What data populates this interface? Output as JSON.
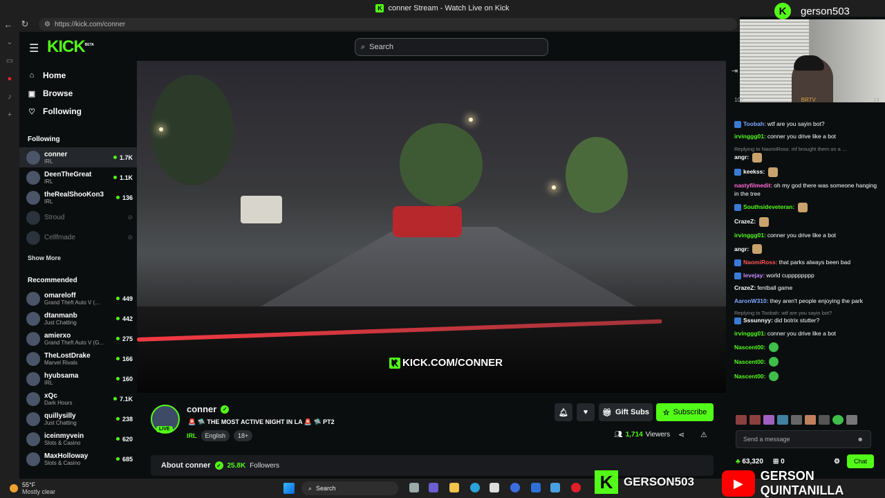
{
  "browser": {
    "tab_title": "conner Stream - Watch Live on Kick",
    "url": "https://kick.com/conner"
  },
  "header": {
    "logo": "KICK",
    "logo_sup": "BETA",
    "search_placeholder": "Search"
  },
  "sidebar": {
    "nav": [
      {
        "label": "Home",
        "icon": "home-icon"
      },
      {
        "label": "Browse",
        "icon": "browse-icon"
      },
      {
        "label": "Following",
        "icon": "heart-icon"
      }
    ],
    "following_title": "Following",
    "following": [
      {
        "name": "conner",
        "sub": "IRL",
        "count": "1.7K",
        "live": true
      },
      {
        "name": "DeenTheGreat",
        "sub": "IRL",
        "count": "1.1K",
        "live": true
      },
      {
        "name": "theRealShooKon3",
        "sub": "IRL",
        "count": "136",
        "live": true
      },
      {
        "name": "Stroud",
        "sub": "",
        "count": "",
        "live": false
      },
      {
        "name": "Cellfmade",
        "sub": "",
        "count": "",
        "live": false
      }
    ],
    "show_more": "Show More",
    "recommended_title": "Recommended",
    "recommended": [
      {
        "name": "omareloff",
        "sub": "Grand Theft Auto V (...",
        "count": "449"
      },
      {
        "name": "dtanmanb",
        "sub": "Just Chatting",
        "count": "442"
      },
      {
        "name": "amierxo",
        "sub": "Grand Theft Auto V (G...",
        "count": "275"
      },
      {
        "name": "TheLostDrake",
        "sub": "Marvel Rivals",
        "count": "166"
      },
      {
        "name": "hyubsama",
        "sub": "IRL",
        "count": "160"
      },
      {
        "name": "xQc",
        "sub": "Dark Hours",
        "count": "7.1K"
      },
      {
        "name": "quillysilly",
        "sub": "Just Chatting",
        "count": "238"
      },
      {
        "name": "iceinmyvein",
        "sub": "Slots & Casino",
        "count": "620"
      },
      {
        "name": "MaxHolloway",
        "sub": "Slots & Casino",
        "count": "685"
      }
    ]
  },
  "video": {
    "watermark": "KICK.COM/CONNER"
  },
  "stream": {
    "username": "conner",
    "live_label": "LIVE",
    "title": "🚨 🛸 THE MOST ACTIVE NIGHT IN LA 🚨 🛸 PT2",
    "category": "IRL",
    "tags": [
      "English",
      "18+"
    ],
    "gift_subs": "Gift Subs",
    "subscribe": "Subscribe",
    "viewers": "1,714",
    "viewers_label": "Viewers",
    "about_label": "About conner",
    "followers": "25.8K",
    "followers_label": "Followers"
  },
  "chat": {
    "pinned_left": "102",
    "pinned_mid": "BRTV",
    "pinned_right": "14",
    "messages": [
      {
        "user": "Toobah:",
        "color": "#7ea8ff",
        "text": "wtf are you sayin bot?",
        "badge": true
      },
      {
        "user": "irvinggg01:",
        "color": "#53fc18",
        "text": "conner you drive like a bot"
      },
      {
        "reply": "Replying to NaomiRoss: mf brought them on a ...",
        "user": "angr:",
        "color": "#ffffff",
        "text": "",
        "emote": "emote"
      },
      {
        "user": "keekss:",
        "color": "#ffffff",
        "text": "",
        "emote": "emote",
        "badge": true
      },
      {
        "user": "nastyfilmedit:",
        "color": "#ff6bd6",
        "text": "oh my god there was someone hanging in the tree"
      },
      {
        "user": "Southsideveteran:",
        "color": "#53fc18",
        "text": "",
        "emote": "emote",
        "badge": true
      },
      {
        "user": "CrazeZ:",
        "color": "#ffffff",
        "text": "",
        "emote": "emote"
      },
      {
        "user": "irvinggg01:",
        "color": "#53fc18",
        "text": "conner you drive like a bot"
      },
      {
        "user": "angr:",
        "color": "#ffffff",
        "text": "",
        "emote": "emote"
      },
      {
        "user": "NaomiRoss:",
        "color": "#ff5555",
        "text": "that parks always been bad",
        "badge": true
      },
      {
        "user": "levejay:",
        "color": "#c78bff",
        "text": "world cupppppppp",
        "badge": true
      },
      {
        "user": "CrazeZ:",
        "color": "#ffffff",
        "text": "fentball game"
      },
      {
        "user": "AaronW310:",
        "color": "#7ea8ff",
        "text": "they aren't people enjoying the park"
      },
      {
        "reply": "Replying to Toobah: wtf are you sayin bot?",
        "user": "Sssunnyy:",
        "color": "#ffffff",
        "text": "did botrix stutter?",
        "badge": true
      },
      {
        "user": "irvinggg01:",
        "color": "#53fc18",
        "text": "conner you drive like a bot"
      },
      {
        "user": "Nascent00:",
        "color": "#53fc18",
        "text": "",
        "emote": "emote frog"
      },
      {
        "user": "Nascent00:",
        "color": "#53fc18",
        "text": "",
        "emote": "emote frog"
      },
      {
        "user": "Nascent00:",
        "color": "#53fc18",
        "text": "",
        "emote": "emote frog"
      }
    ],
    "placeholder": "Send a message",
    "points": "63,320",
    "count": "0",
    "chat_button": "Chat"
  },
  "overlay": {
    "top_name": "gerson503",
    "bottom_name": "GERSON503",
    "yt_name": "GERSON QUINTANILLA"
  },
  "taskbar": {
    "temp": "55°F",
    "weather": "Mostly clear",
    "search": "Search"
  }
}
